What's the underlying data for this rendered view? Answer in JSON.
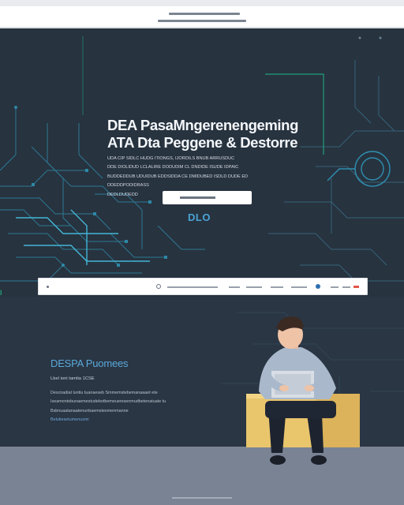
{
  "topbar": {
    "lines": [
      "▬▬▬▬▬▬▬▬▬▬▬▬▬▬",
      "▬▬▬▬▬▬▬▬▬▬▬▬▬▬"
    ]
  },
  "hero": {
    "title_line1": "DEA PasaMngerenengeming",
    "title_line2": "ATA Dta Peggene & Destorre",
    "desc_lines": [
      "UDA CIP SIDLC HUDG ITIONGS, IJORDILS BNUB ARRUSDUC",
      "DDE DIOLIDUD LCLALIRE DODUDIM CL DNDIDE ISUDE IDPAIC",
      "BUDDEDDUB UDUIDUB EDDSIDDA CE DMIDUBED ISDLD DUDE ED",
      "DDEDDPODIDRASS",
      "DEDLDUDEDD"
    ],
    "stat": "DLO"
  },
  "navbar": {},
  "side_mark": "l",
  "lower": {
    "title": "DESPA Puomees",
    "subtitle": "Lbel ioni tamtia 1CSE",
    "body_lines": [
      "Descnadiat luntiu tuanaeseb Smmemstebemanaaaet ete",
      "Iseamontebunaemestudebotbemeueresenmudbetenatuate tu",
      "Bsbnuaatanaatenunbaemstesmenmanne",
      "Belutiesetumenusmi"
    ]
  },
  "colors": {
    "hero_bg": "#27333f",
    "lower_bg": "#2a3644",
    "accent_blue": "#4aa3d6",
    "accent_green": "#1fa07a",
    "crate": "#e9c56c"
  }
}
